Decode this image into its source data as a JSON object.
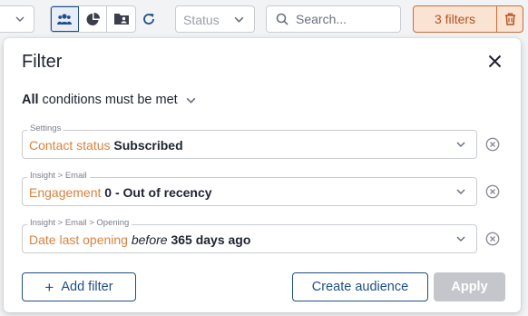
{
  "toolbar": {
    "views": [
      {
        "icon": "people-icon",
        "active": true
      },
      {
        "icon": "pie-chart-icon",
        "active": false
      },
      {
        "icon": "folder-user-icon",
        "active": false
      }
    ],
    "status_placeholder": "Status",
    "search_placeholder": "Search...",
    "filters_label": "3 filters"
  },
  "panel": {
    "title": "Filter",
    "conditions_quantifier": "All",
    "conditions_rest": " conditions must be met",
    "filters": [
      {
        "path": "Settings",
        "field": "Contact status",
        "operator": "",
        "value": "Subscribed"
      },
      {
        "path": "Insight > Email",
        "field": "Engagement",
        "operator": "",
        "value": "0 - Out of recency"
      },
      {
        "path": "Insight > Email > Opening",
        "field": "Date last opening",
        "operator": "before",
        "value": "365 days ago"
      }
    ],
    "add_filter_label": "Add filter",
    "create_audience_label": "Create audience",
    "apply_label": "Apply"
  },
  "colors": {
    "primary": "#1f4f86",
    "accent_orange": "#d9823f",
    "filters_bg": "#fbe3d3",
    "disabled": "#c4c6cb"
  }
}
